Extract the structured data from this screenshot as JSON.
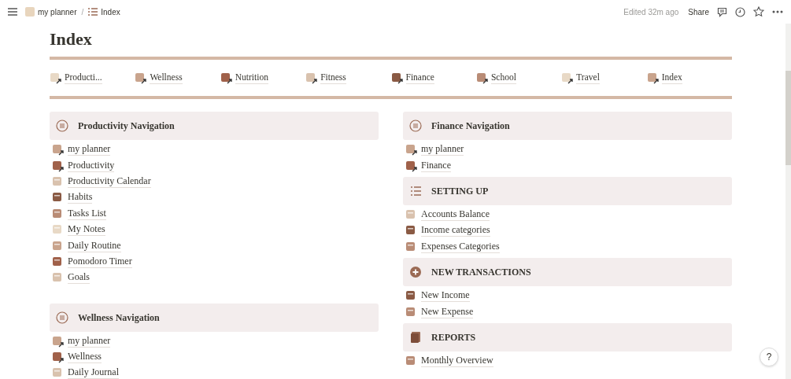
{
  "topbar": {
    "breadcrumbs": [
      {
        "label": "my planner"
      },
      {
        "label": "Index"
      }
    ],
    "separator": "/",
    "edited": "Edited 32m ago",
    "share": "Share"
  },
  "title": "Index",
  "nav": [
    {
      "label": "Producti..."
    },
    {
      "label": "Wellness"
    },
    {
      "label": "Nutrition"
    },
    {
      "label": "Fitness"
    },
    {
      "label": "Finance"
    },
    {
      "label": "School"
    },
    {
      "label": "Travel"
    },
    {
      "label": "Index"
    }
  ],
  "columns": [
    {
      "sections": [
        {
          "heading": "Productivity Navigation",
          "items": [
            {
              "label": "my planner",
              "kind": "link"
            },
            {
              "label": "Productivity",
              "kind": "link"
            },
            {
              "label": "Productivity Calendar",
              "kind": "page"
            },
            {
              "label": "Habits",
              "kind": "page"
            },
            {
              "label": "Tasks List",
              "kind": "page"
            },
            {
              "label": "My Notes",
              "kind": "page"
            },
            {
              "label": "Daily Routine",
              "kind": "page"
            },
            {
              "label": "Pomodoro Timer",
              "kind": "page"
            },
            {
              "label": "Goals",
              "kind": "page"
            }
          ]
        },
        {
          "heading": "Wellness Navigation",
          "items": [
            {
              "label": "my planner",
              "kind": "link"
            },
            {
              "label": "Wellness",
              "kind": "link"
            },
            {
              "label": "Daily Journal",
              "kind": "page"
            }
          ]
        }
      ]
    },
    {
      "sections": [
        {
          "heading": "Finance Navigation",
          "items": [
            {
              "label": "my planner",
              "kind": "link"
            },
            {
              "label": "Finance",
              "kind": "link"
            }
          ]
        },
        {
          "heading": "SETTING UP",
          "items": [
            {
              "label": "Accounts Balance",
              "kind": "page"
            },
            {
              "label": "Income categories",
              "kind": "page"
            },
            {
              "label": "Expenses Categories",
              "kind": "page"
            }
          ]
        },
        {
          "heading": "NEW TRANSACTIONS",
          "items": [
            {
              "label": "New Income",
              "kind": "page"
            },
            {
              "label": "New Expense",
              "kind": "page"
            }
          ]
        },
        {
          "heading": "REPORTS",
          "items": [
            {
              "label": "Monthly Overview",
              "kind": "page"
            }
          ]
        }
      ]
    }
  ],
  "help": "?"
}
